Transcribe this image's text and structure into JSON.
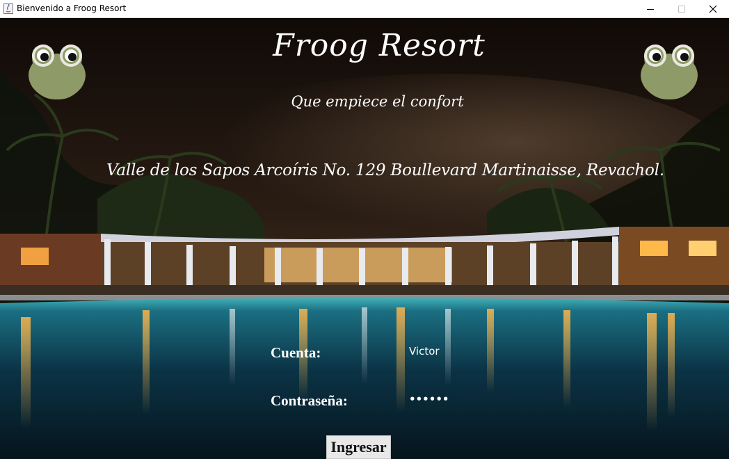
{
  "window": {
    "title": "Bienvenido a Froog Resort"
  },
  "header": {
    "title": "Froog Resort",
    "tagline": "Que empiece el confort",
    "address": "Valle de los Sapos Arcoíris No. 129 Boullevard Martinaisse, Revachol."
  },
  "login": {
    "account_label": "Cuenta:",
    "account_value": "Victor",
    "password_label": "Contraseña:",
    "password_value": "••••••",
    "submit_label": "Ingresar"
  },
  "colors": {
    "frog_green": "#8e9a68",
    "sky_top": "#120c09",
    "pool": "#1a7f8f",
    "light_warm": "#f0a040"
  }
}
